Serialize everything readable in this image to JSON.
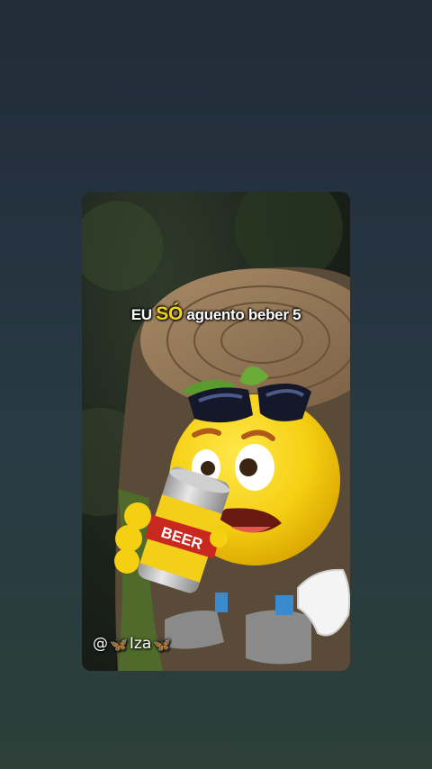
{
  "video": {
    "caption": {
      "part1": "EU",
      "highlight": "SÓ",
      "part2": "aguento beber 5"
    },
    "watermark": {
      "at": "@",
      "name": "Iza"
    },
    "can_label": "BEER",
    "colors": {
      "highlight": "#f3d21a",
      "emoji_yellow": "#f5cf12",
      "can_red": "#c8281e"
    }
  }
}
